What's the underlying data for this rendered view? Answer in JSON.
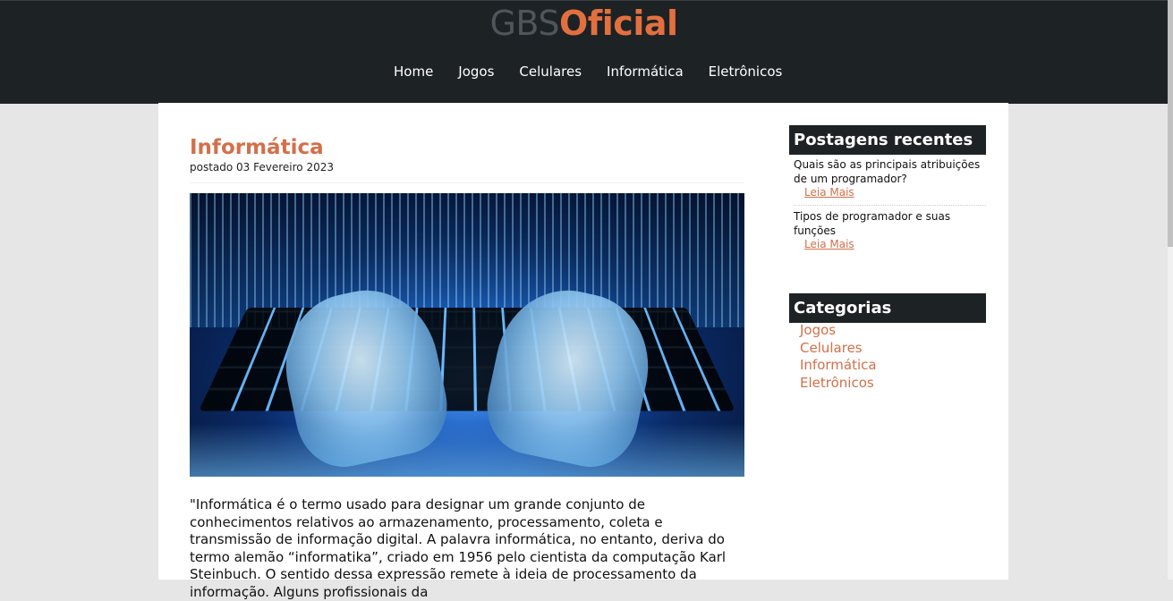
{
  "brand": {
    "part1": "GBS",
    "part2": "Oficial",
    "colors": {
      "part1": "#4e565c",
      "part2": "#e2703f"
    }
  },
  "nav": [
    {
      "label": "Home"
    },
    {
      "label": "Jogos"
    },
    {
      "label": "Celulares"
    },
    {
      "label": "Informática"
    },
    {
      "label": "Eletrônicos"
    }
  ],
  "post": {
    "title": "Informática",
    "date": "postado 03 Fevereiro 2023",
    "image_icon": "keyboard-hands-image",
    "body": "\"Informática é o termo usado para designar um grande conjunto de conhecimentos relativos ao armazenamento, processamento, coleta e transmissão de informação digital. A palavra informática, no entanto, deriva do termo alemão “informatika”, criado em 1956 pelo cientista da computação Karl Steinbuch. O sentido dessa expressão remete à ideia de processamento da informação. Alguns profissionais da"
  },
  "sidebar": {
    "recent": {
      "title": "Postagens recentes",
      "items": [
        {
          "title": "Quais são as principais atribuições de um programador?",
          "more": "Leia Mais"
        },
        {
          "title": "Tipos de programador e suas funções",
          "more": "Leia Mais"
        }
      ]
    },
    "categories": {
      "title": "Categorias",
      "items": [
        "Jogos",
        "Celulares",
        "Informática",
        "Eletrônicos"
      ]
    }
  },
  "colors": {
    "header_bg": "#1d2225",
    "accent": "#d2704a",
    "page_bg": "#e6e6e6",
    "content_bg": "#ffffff"
  }
}
